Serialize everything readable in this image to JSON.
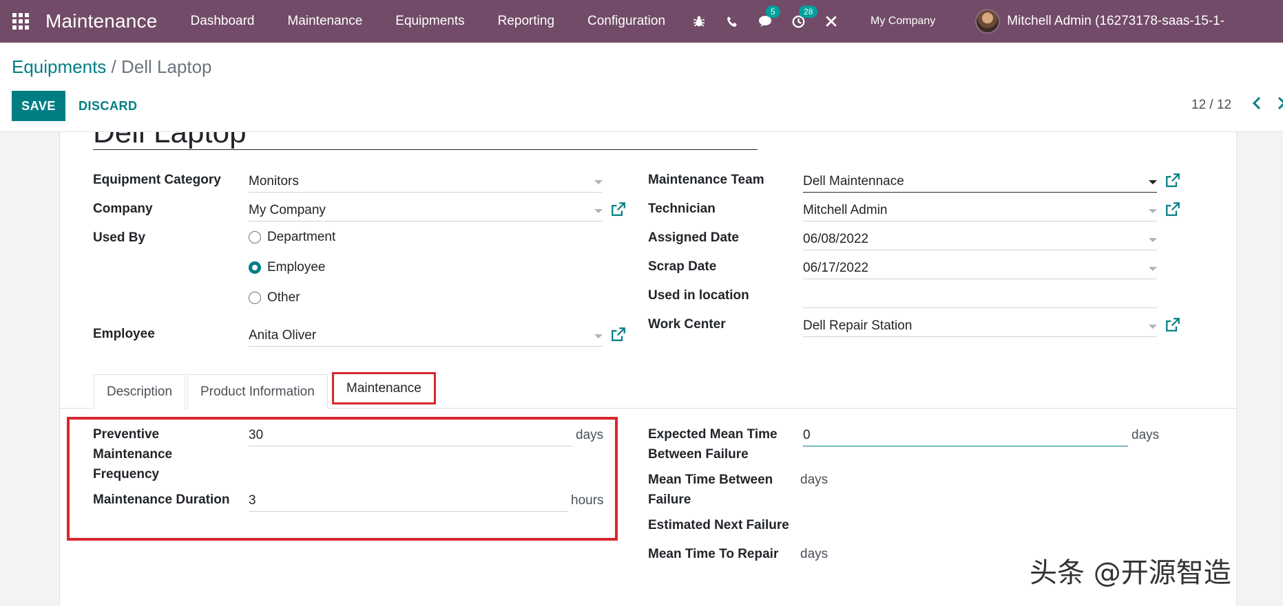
{
  "navbar": {
    "app_name": "Maintenance",
    "menu": [
      "Dashboard",
      "Maintenance",
      "Equipments",
      "Reporting",
      "Configuration"
    ],
    "icons": [
      "bug-icon",
      "phone-icon",
      "chat-icon",
      "activity-icon",
      "tools-icon"
    ],
    "chat_badge": "5",
    "activity_badge": "28",
    "company": "My Company",
    "user": "Mitchell Admin (16273178-saas-15-1-"
  },
  "control": {
    "breadcrumb_parent": "Equipments",
    "breadcrumb_sep": " / ",
    "breadcrumb_current": "Dell Laptop",
    "save_label": "SAVE",
    "discard_label": "DISCARD",
    "pager": "12 / 12"
  },
  "form": {
    "title": "Dell Laptop",
    "left": {
      "equipment_category_label": "Equipment Category",
      "equipment_category": "Monitors",
      "company_label": "Company",
      "company": "My Company",
      "used_by_label": "Used By",
      "used_by_options": [
        "Department",
        "Employee",
        "Other"
      ],
      "used_by_selected": "Employee",
      "employee_label": "Employee",
      "employee": "Anita Oliver"
    },
    "right": {
      "team_label": "Maintenance Team",
      "team": "Dell Maintennace",
      "technician_label": "Technician",
      "technician": "Mitchell Admin",
      "assigned_date_label": "Assigned Date",
      "assigned_date": "06/08/2022",
      "scrap_date_label": "Scrap Date",
      "scrap_date": "06/17/2022",
      "location_label": "Used in location",
      "location": "",
      "work_center_label": "Work Center",
      "work_center": "Dell Repair Station"
    }
  },
  "tabs": [
    "Description",
    "Product Information",
    "Maintenance"
  ],
  "active_tab": "Maintenance",
  "maintenance": {
    "pm_frequency_label": "Preventive Maintenance Frequency",
    "pm_frequency": "30",
    "pm_frequency_unit": "days",
    "duration_label": "Maintenance Duration",
    "duration": "3",
    "duration_unit": "hours",
    "expected_mtbf_label": "Expected Mean Time Between Failure",
    "expected_mtbf": "0",
    "expected_mtbf_unit": "days",
    "mtbf_label": "Mean Time Between Failure",
    "mtbf_unit": "days",
    "next_failure_label": "Estimated Next Failure",
    "mttr_label": "Mean Time To Repair",
    "mttr_unit": "days"
  },
  "watermark": "头条 @开源智造",
  "colors": {
    "navbar": "#714b67",
    "accent": "#017e84",
    "highlight": "#d9262e"
  }
}
